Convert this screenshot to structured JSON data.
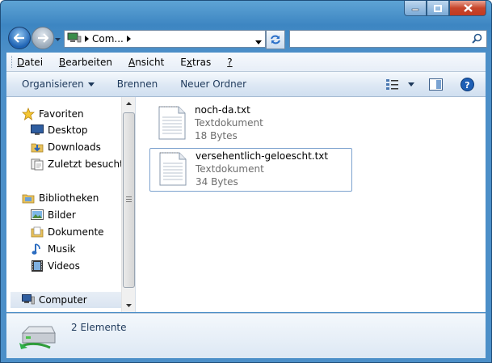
{
  "window": {
    "colors": {
      "frame": "#4c8fc8",
      "close": "#c7452b",
      "accent": "#1e63b4"
    }
  },
  "address": {
    "crumb": "Com...",
    "icon": "computer-icon"
  },
  "search": {
    "placeholder": "",
    "value": ""
  },
  "menu": {
    "items": [
      {
        "label": "Datei",
        "key": "D"
      },
      {
        "label": "Bearbeiten",
        "key": "B"
      },
      {
        "label": "Ansicht",
        "key": "A"
      },
      {
        "label": "Extras",
        "key": "x"
      },
      {
        "label": "?",
        "key": "?"
      }
    ]
  },
  "toolbar": {
    "organize": "Organisieren",
    "burn": "Brennen",
    "new_folder": "Neuer Ordner"
  },
  "navigation": {
    "favorites": {
      "label": "Favoriten",
      "items": [
        {
          "label": "Desktop",
          "icon": "desktop-icon"
        },
        {
          "label": "Downloads",
          "icon": "downloads-icon"
        },
        {
          "label": "Zuletzt besucht",
          "icon": "recent-places-icon"
        }
      ]
    },
    "libraries": {
      "label": "Bibliotheken",
      "items": [
        {
          "label": "Bilder",
          "icon": "pictures-icon"
        },
        {
          "label": "Dokumente",
          "icon": "documents-icon"
        },
        {
          "label": "Musik",
          "icon": "music-icon"
        },
        {
          "label": "Videos",
          "icon": "videos-icon"
        }
      ]
    },
    "computer": {
      "label": "Computer",
      "icon": "computer-icon"
    }
  },
  "files": [
    {
      "name": "noch-da.txt",
      "type": "Textdokument",
      "size": "18 Bytes",
      "selected": false
    },
    {
      "name": "versehentlich-geloescht.txt",
      "type": "Textdokument",
      "size": "34 Bytes",
      "selected": true
    }
  ],
  "details": {
    "count": "2 Elemente"
  }
}
